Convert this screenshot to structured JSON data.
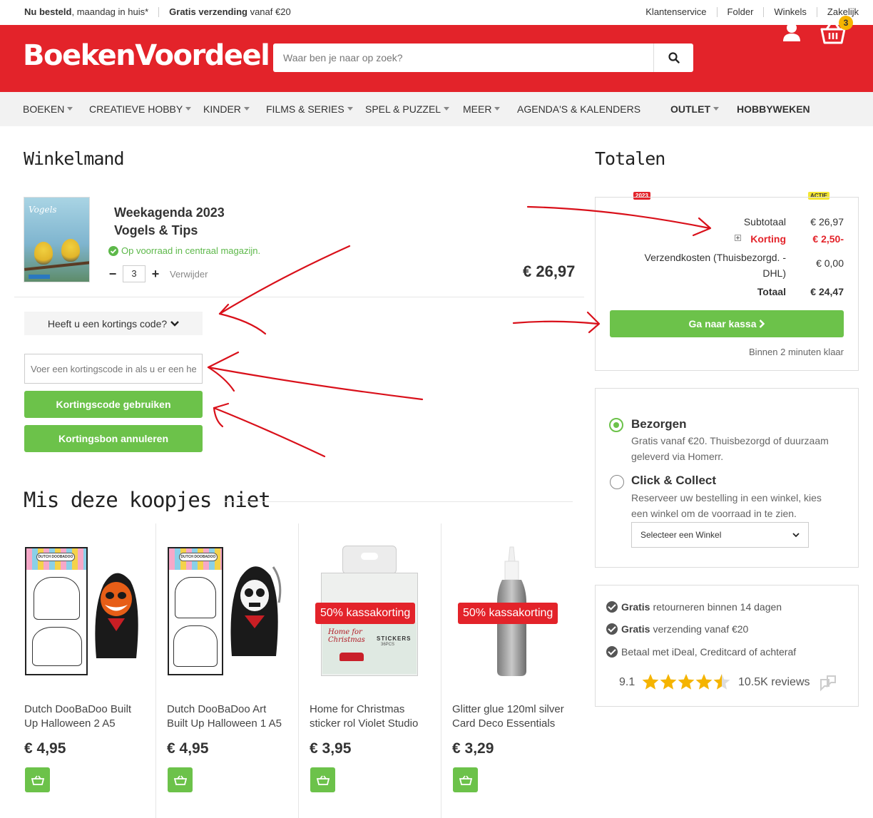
{
  "topbar": {
    "promo1_bold": "Nu besteld",
    "promo1_rest": ", maandag in huis*",
    "promo2_bold": "Gratis verzending",
    "promo2_rest": " vanaf €20",
    "links": [
      "Klantenservice",
      "Folder",
      "Winkels",
      "Zakelijk"
    ]
  },
  "header": {
    "logo": "BoekenVoordeel",
    "search_placeholder": "Waar ben je naar op zoek?",
    "cart_count": "3"
  },
  "nav": {
    "items": [
      "BOEKEN",
      "CREATIEVE HOBBY",
      "KINDER",
      "FILMS & SERIES",
      "SPEL & PUZZEL",
      "MEER",
      "AGENDA'S & KALENDERS",
      "OUTLET",
      "HOBBYWEKEN"
    ],
    "badge_agenda": "2023",
    "badge_hobby": "ACTIE"
  },
  "cart": {
    "heading": "Winkelmand",
    "item": {
      "cover_title": "Vogels",
      "title_line1": "Weekagenda 2023",
      "title_line2": "Vogels & Tips",
      "stock": "Op voorraad in centraal magazijn.",
      "quantity": "3",
      "remove": "Verwijder",
      "price": "€ 26,97"
    },
    "coupon_toggle": "Heeft u een kortings code?",
    "coupon_placeholder": "Voer een kortingscode in als u er een heeft",
    "apply_button": "Kortingscode gebruiken",
    "cancel_button": "Kortingsbon annuleren"
  },
  "totals": {
    "heading": "Totalen",
    "subtotal_label": "Subtotaal",
    "subtotal_value": "€ 26,97",
    "discount_label": "Korting",
    "discount_value": "€ 2,50-",
    "shipping_label_1": "Verzendkosten (Thuisbezorgd. -",
    "shipping_label_2": "DHL)",
    "shipping_value": "€ 0,00",
    "total_label": "Totaal",
    "total_value": "€ 24,47",
    "checkout_button": "Ga naar kassa",
    "checkout_note": "Binnen 2 minuten klaar"
  },
  "delivery": {
    "option1_title": "Bezorgen",
    "option1_desc_1": "Gratis vanaf €20. Thuisbezorgd of duurzaam",
    "option1_desc_2": "geleverd via Homerr.",
    "option2_title": "Click & Collect",
    "option2_desc_1": "Reserveer uw bestelling in een winkel, kies",
    "option2_desc_2": "een winkel om de voorraad in te zien.",
    "store_select": "Selecteer een Winkel",
    "selected": "Bezorgen"
  },
  "usp": {
    "row1_bold": "Gratis",
    "row1_rest": "retourneren binnen 14 dagen",
    "row2_bold": "Gratis",
    "row2_rest": "verzending vanaf €20",
    "row3": "Betaal met iDeal, Creditcard of achteraf",
    "rating": "9.1",
    "rating_stars": 4.5,
    "reviews": "10.5K reviews"
  },
  "bargains": {
    "heading": "Mis deze koopjes niet",
    "products": [
      {
        "name_1": "Dutch DooBaDoo Built",
        "name_2": "Up Halloween 2 A5",
        "price": "€ 4,95",
        "promo": "",
        "brand": "DUTCH DOOBADOO"
      },
      {
        "name_1": "Dutch DooBaDoo Art",
        "name_2": "Built Up Halloween 1 A5",
        "price": "€ 4,95",
        "promo": "",
        "brand": "DUTCH DOOBADOO"
      },
      {
        "name_1": "Home for Christmas",
        "name_2": "sticker rol Violet Studio",
        "price": "€ 3,95",
        "promo": "50% kassakorting",
        "img_text_1": "Home for",
        "img_text_2": "Christmas",
        "img_text_3": "STICKERS",
        "img_text_4": "36PCS"
      },
      {
        "name_1": "Glitter glue 120ml silver",
        "name_2": "Card Deco Essentials",
        "price": "€ 3,29",
        "promo": "50% kassakorting"
      }
    ]
  },
  "colors": {
    "brand_red": "#e3232a",
    "green": "#6cc24a",
    "star": "#f5b400",
    "annotation_red": "#d9101a"
  }
}
